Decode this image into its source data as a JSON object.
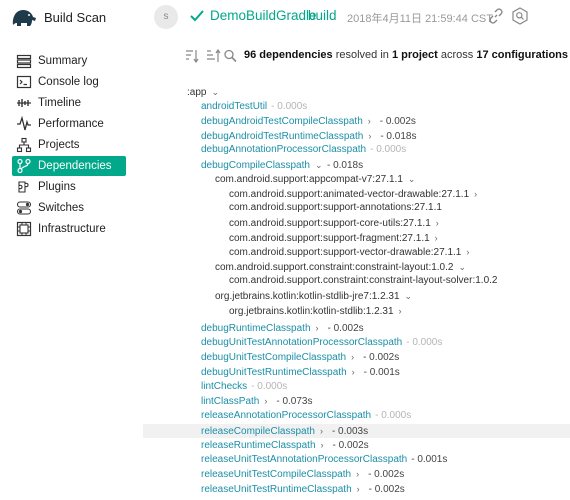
{
  "header": {
    "app_title": "Build Scan",
    "avatar_initial": "s",
    "project": "DemoBuildGradle",
    "build_label": "build",
    "timestamp": "2018年4月11日 21:59:44 CST",
    "accent": "#02a88a"
  },
  "sidebar": {
    "items": [
      {
        "label": "Summary",
        "icon": "summary-icon"
      },
      {
        "label": "Console log",
        "icon": "console-icon"
      },
      {
        "label": "Timeline",
        "icon": "timeline-icon"
      },
      {
        "label": "Performance",
        "icon": "performance-icon"
      },
      {
        "label": "Projects",
        "icon": "projects-icon"
      },
      {
        "label": "Dependencies",
        "icon": "dependencies-icon",
        "active": true
      },
      {
        "label": "Plugins",
        "icon": "plugins-icon"
      },
      {
        "label": "Switches",
        "icon": "switches-icon"
      },
      {
        "label": "Infrastructure",
        "icon": "infrastructure-icon"
      }
    ]
  },
  "summary": {
    "count": "96 dependencies",
    "resolved_in": " resolved in ",
    "projects": "1 project",
    "across": " across ",
    "configs": "17 configurations"
  },
  "tree": [
    {
      "name": "app",
      "dark": true,
      "chevron": "down"
    },
    {
      "name": "androidTestUtil",
      "dur": "- 0.000s",
      "faint": true
    },
    {
      "name": "debugAndroidTestCompileClasspath",
      "dur": "- 0.002s",
      "chevron": "right"
    },
    {
      "name": "debugAndroidTestRuntimeClasspath",
      "dur": "- 0.018s",
      "chevron": "right"
    },
    {
      "name": "debugAnnotationProcessorClasspath",
      "dur": "- 0.000s",
      "faint": true
    },
    {
      "name": "debugCompileClasspath",
      "dur": "- 0.018s",
      "chevron": "down"
    },
    {
      "name": "com.android.support:appcompat-v7:27.1.1",
      "dark": true,
      "chevron": "down"
    },
    {
      "name": "com.android.support:animated-vector-drawable:27.1.1",
      "dark": true,
      "chevron": "right"
    },
    {
      "name": "com.android.support:support-annotations:27.1.1",
      "dark": true
    },
    {
      "name": "com.android.support:support-core-utils:27.1.1",
      "dark": true,
      "chevron": "right"
    },
    {
      "name": "com.android.support:support-fragment:27.1.1",
      "dark": true,
      "chevron": "right"
    },
    {
      "name": "com.android.support:support-vector-drawable:27.1.1",
      "dark": true,
      "chevron": "right"
    },
    {
      "name": "com.android.support.constraint:constraint-layout:1.0.2",
      "dark": true,
      "chevron": "down"
    },
    {
      "name": "com.android.support.constraint:constraint-layout-solver:1.0.2",
      "dark": true
    },
    {
      "name": "org.jetbrains.kotlin:kotlin-stdlib-jre7:1.2.31",
      "dark": true,
      "chevron": "down"
    },
    {
      "name": "org.jetbrains.kotlin:kotlin-stdlib:1.2.31",
      "dark": true,
      "chevron": "right"
    },
    {
      "name": "debugRuntimeClasspath",
      "dur": "- 0.002s",
      "chevron": "right"
    },
    {
      "name": "debugUnitTestAnnotationProcessorClasspath",
      "dur": "- 0.000s",
      "faint": true
    },
    {
      "name": "debugUnitTestCompileClasspath",
      "dur": "- 0.002s",
      "chevron": "right"
    },
    {
      "name": "debugUnitTestRuntimeClasspath",
      "dur": "- 0.001s",
      "chevron": "right"
    },
    {
      "name": "lintChecks",
      "dur": "- 0.000s",
      "faint": true
    },
    {
      "name": "lintClassPath",
      "dur": "- 0.073s",
      "chevron": "right"
    },
    {
      "name": "releaseAnnotationProcessorClasspath",
      "dur": "- 0.000s",
      "faint": true
    },
    {
      "name": "releaseCompileClasspath",
      "dur": "- 0.003s",
      "chevron": "right",
      "highlight": true
    },
    {
      "name": "releaseRuntimeClasspath",
      "dur": "- 0.002s",
      "chevron": "right"
    },
    {
      "name": "releaseUnitTestAnnotationProcessorClasspath",
      "dur": "- 0.001s"
    },
    {
      "name": "releaseUnitTestCompileClasspath",
      "dur": "- 0.002s",
      "chevron": "right"
    },
    {
      "name": "releaseUnitTestRuntimeClasspath",
      "dur": "- 0.002s",
      "chevron": "right"
    }
  ]
}
